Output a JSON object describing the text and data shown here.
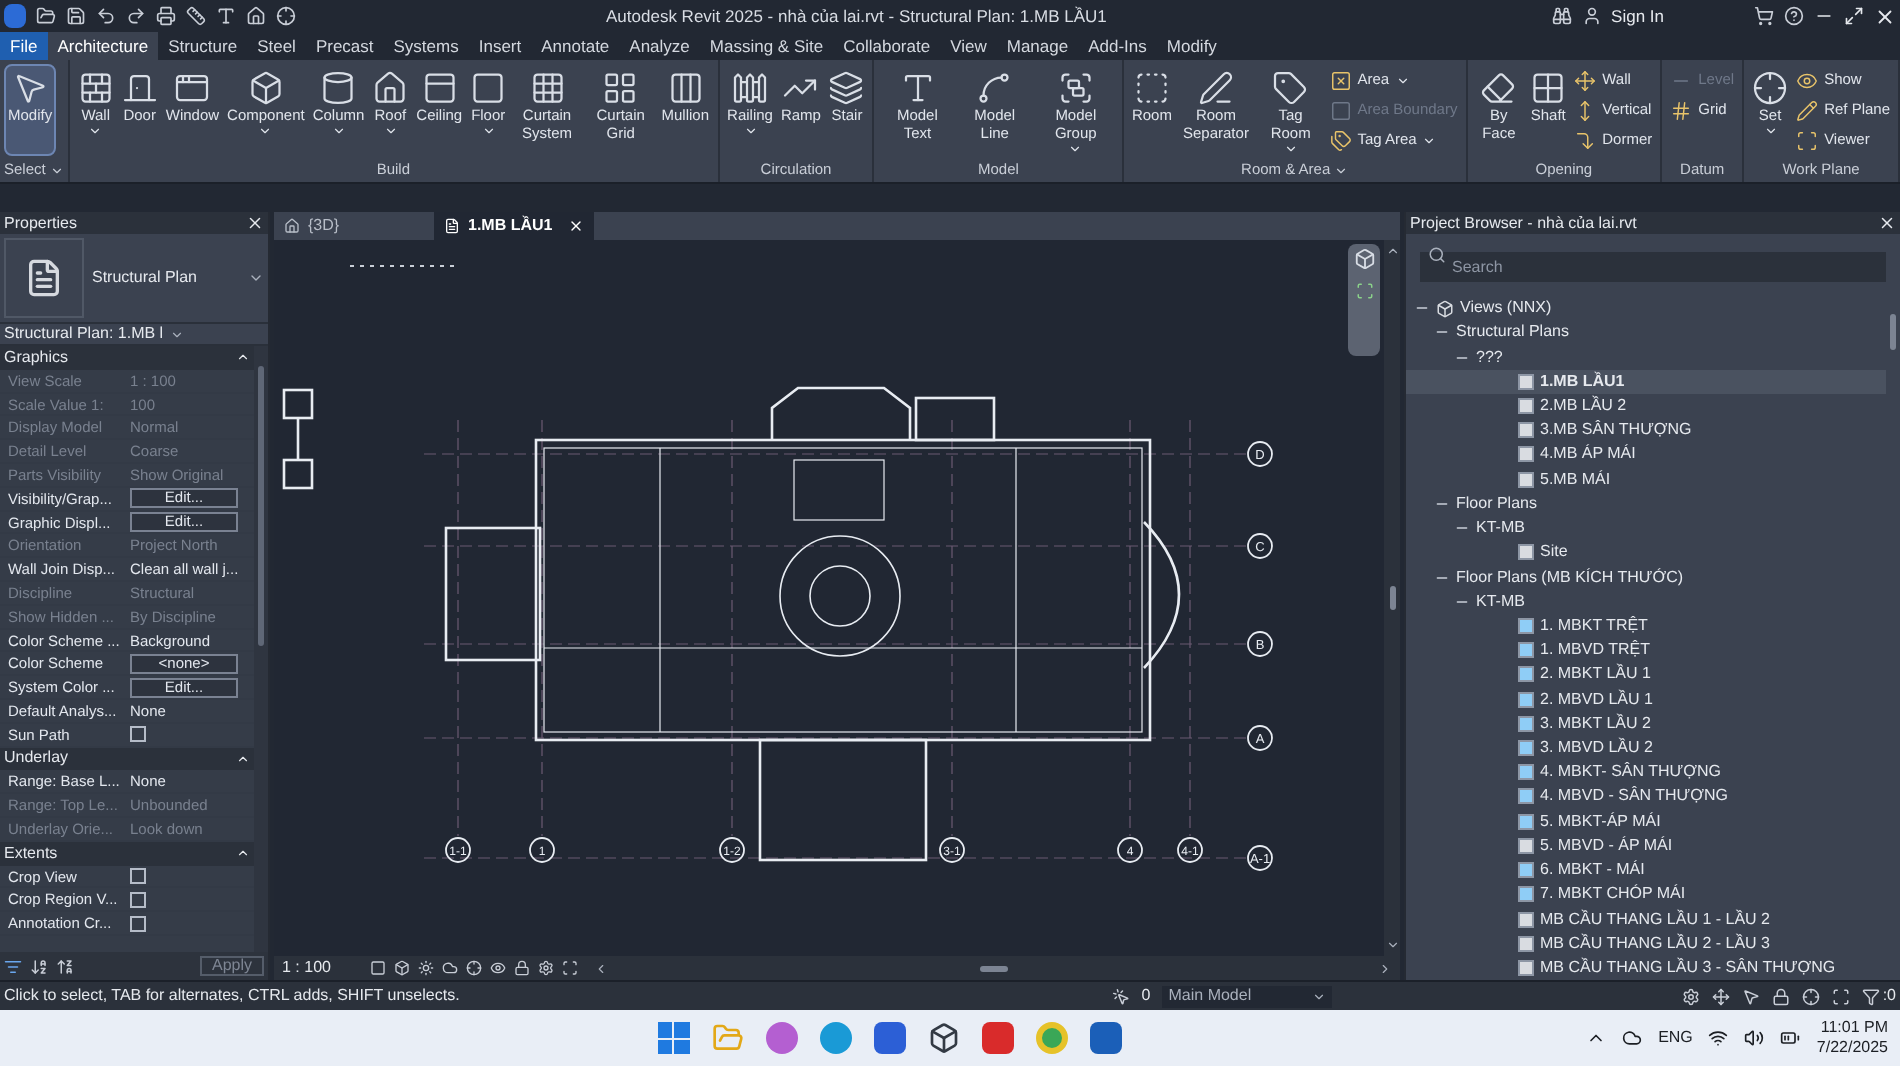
{
  "title_bar": {
    "title": "Autodesk Revit 2025 - nhà của lai.rvt - Structural Plan: 1.MB LẦU1",
    "sign_in": "Sign In"
  },
  "tabs": [
    {
      "label": "File",
      "selected": false,
      "kind": "file"
    },
    {
      "label": "Architecture",
      "selected": true,
      "kind": "tab"
    },
    {
      "label": "Structure",
      "selected": false,
      "kind": "tab"
    },
    {
      "label": "Steel",
      "selected": false,
      "kind": "tab"
    },
    {
      "label": "Precast",
      "selected": false,
      "kind": "tab"
    },
    {
      "label": "Systems",
      "selected": false,
      "kind": "tab"
    },
    {
      "label": "Insert",
      "selected": false,
      "kind": "tab"
    },
    {
      "label": "Annotate",
      "selected": false,
      "kind": "tab"
    },
    {
      "label": "Analyze",
      "selected": false,
      "kind": "tab"
    },
    {
      "label": "Massing & Site",
      "selected": false,
      "kind": "tab"
    },
    {
      "label": "Collaborate",
      "selected": false,
      "kind": "tab"
    },
    {
      "label": "View",
      "selected": false,
      "kind": "tab"
    },
    {
      "label": "Manage",
      "selected": false,
      "kind": "tab"
    },
    {
      "label": "Add-Ins",
      "selected": false,
      "kind": "tab"
    },
    {
      "label": "Modify",
      "selected": false,
      "kind": "tab"
    }
  ],
  "ribbon": {
    "panels": [
      {
        "label": "Select",
        "dropdown": true,
        "items": [
          {
            "label": "Modify",
            "kind": "large",
            "active": true,
            "disabled": false,
            "dropdown": false
          }
        ]
      },
      {
        "label": "Build",
        "dropdown": false,
        "items": [
          {
            "label": "Wall",
            "kind": "large",
            "active": false,
            "disabled": false,
            "dropdown": true
          },
          {
            "label": "Door",
            "kind": "large",
            "active": false,
            "disabled": false,
            "dropdown": false
          },
          {
            "label": "Window",
            "kind": "large",
            "active": false,
            "disabled": false,
            "dropdown": false
          },
          {
            "label": "Component",
            "kind": "large",
            "active": false,
            "disabled": false,
            "dropdown": true
          },
          {
            "label": "Column",
            "kind": "large",
            "active": false,
            "disabled": false,
            "dropdown": true
          },
          {
            "label": "Roof",
            "kind": "large",
            "active": false,
            "disabled": false,
            "dropdown": true
          },
          {
            "label": "Ceiling",
            "kind": "large",
            "active": false,
            "disabled": false,
            "dropdown": false
          },
          {
            "label": "Floor",
            "kind": "large",
            "active": false,
            "disabled": false,
            "dropdown": true
          },
          {
            "label": "Curtain System",
            "kind": "large",
            "active": false,
            "disabled": false,
            "dropdown": false
          },
          {
            "label": "Curtain Grid",
            "kind": "large",
            "active": false,
            "disabled": false,
            "dropdown": false
          },
          {
            "label": "Mullion",
            "kind": "large",
            "active": false,
            "disabled": false,
            "dropdown": false
          }
        ]
      },
      {
        "label": "Circulation",
        "dropdown": false,
        "items": [
          {
            "label": "Railing",
            "kind": "large",
            "active": false,
            "disabled": false,
            "dropdown": true
          },
          {
            "label": "Ramp",
            "kind": "large",
            "active": false,
            "disabled": false,
            "dropdown": false
          },
          {
            "label": "Stair",
            "kind": "large",
            "active": false,
            "disabled": false,
            "dropdown": false
          }
        ]
      },
      {
        "label": "Model",
        "dropdown": false,
        "items": [
          {
            "label": "Model Text",
            "kind": "large",
            "active": false,
            "disabled": false,
            "dropdown": false
          },
          {
            "label": "Model Line",
            "kind": "large",
            "active": false,
            "disabled": false,
            "dropdown": false
          },
          {
            "label": "Model Group",
            "kind": "large",
            "active": false,
            "disabled": false,
            "dropdown": true
          }
        ]
      },
      {
        "label": "Room & Area",
        "dropdown": true,
        "items": [
          {
            "label": "Room",
            "kind": "large",
            "active": false,
            "disabled": false,
            "dropdown": false
          },
          {
            "label": "Room Separator",
            "kind": "large",
            "active": false,
            "disabled": false,
            "dropdown": false
          },
          {
            "label": "Tag Room",
            "kind": "large",
            "active": false,
            "disabled": false,
            "dropdown": true
          },
          {
            "label": "Area",
            "kind": "small",
            "active": false,
            "disabled": false,
            "dropdown": true
          },
          {
            "label": "Area Boundary",
            "kind": "small",
            "active": false,
            "disabled": true,
            "dropdown": false
          },
          {
            "label": "Tag  Area",
            "kind": "small",
            "active": false,
            "disabled": false,
            "dropdown": true
          }
        ]
      },
      {
        "label": "Opening",
        "dropdown": false,
        "items": [
          {
            "label": "By Face",
            "kind": "large",
            "active": false,
            "disabled": false,
            "dropdown": false
          },
          {
            "label": "Shaft",
            "kind": "large",
            "active": false,
            "disabled": false,
            "dropdown": false
          },
          {
            "label": "Wall",
            "kind": "small",
            "active": false,
            "disabled": false,
            "dropdown": false
          },
          {
            "label": "Vertical",
            "kind": "small",
            "active": false,
            "disabled": false,
            "dropdown": false
          },
          {
            "label": "Dormer",
            "kind": "small",
            "active": false,
            "disabled": false,
            "dropdown": false
          }
        ]
      },
      {
        "label": "Datum",
        "dropdown": false,
        "items": [
          {
            "label": "Level",
            "kind": "small",
            "active": false,
            "disabled": true,
            "dropdown": false
          },
          {
            "label": "Grid",
            "kind": "small",
            "active": false,
            "disabled": false,
            "dropdown": false
          }
        ]
      },
      {
        "label": "Work Plane",
        "dropdown": false,
        "items": [
          {
            "label": "Set",
            "kind": "large",
            "active": false,
            "disabled": false,
            "dropdown": true
          },
          {
            "label": "Show",
            "kind": "small",
            "active": false,
            "disabled": false,
            "dropdown": false
          },
          {
            "label": "Ref Plane",
            "kind": "small",
            "active": false,
            "disabled": false,
            "dropdown": false
          },
          {
            "label": "Viewer",
            "kind": "small",
            "active": false,
            "disabled": false,
            "dropdown": false
          }
        ]
      }
    ]
  },
  "properties": {
    "title": "Properties",
    "type_name": "Structural Plan",
    "selector": "Structural Plan: 1.MB l",
    "sections": [
      {
        "title": "Graphics",
        "rows": [
          {
            "label": "View Scale",
            "value": "1 : 100",
            "kind": "text",
            "disabled": true
          },
          {
            "label": "Scale Value    1:",
            "value": "100",
            "kind": "text",
            "disabled": true
          },
          {
            "label": "Display Model",
            "value": "Normal",
            "kind": "text",
            "disabled": true
          },
          {
            "label": "Detail Level",
            "value": "Coarse",
            "kind": "text",
            "disabled": true
          },
          {
            "label": "Parts Visibility",
            "value": "Show Original",
            "kind": "text",
            "disabled": true
          },
          {
            "label": "Visibility/Grap...",
            "value": "Edit...",
            "kind": "button",
            "disabled": false
          },
          {
            "label": "Graphic Displ...",
            "value": "Edit...",
            "kind": "button",
            "disabled": false
          },
          {
            "label": "Orientation",
            "value": "Project North",
            "kind": "text",
            "disabled": true
          },
          {
            "label": "Wall Join Disp...",
            "value": "Clean all wall j...",
            "kind": "text",
            "disabled": false
          },
          {
            "label": "Discipline",
            "value": "Structural",
            "kind": "text",
            "disabled": true
          },
          {
            "label": "Show Hidden ...",
            "value": "By Discipline",
            "kind": "text",
            "disabled": true
          },
          {
            "label": "Color Scheme ...",
            "value": "Background",
            "kind": "text",
            "disabled": false
          },
          {
            "label": "Color Scheme",
            "value": "<none>",
            "kind": "button",
            "disabled": false
          },
          {
            "label": "System Color ...",
            "value": "Edit...",
            "kind": "button",
            "disabled": false
          },
          {
            "label": "Default Analys...",
            "value": "None",
            "kind": "text",
            "disabled": false
          },
          {
            "label": "Sun Path",
            "kind": "checkbox",
            "checked": false,
            "disabled": false
          }
        ]
      },
      {
        "title": "Underlay",
        "rows": [
          {
            "label": "Range: Base L...",
            "value": "None",
            "kind": "text",
            "disabled": false
          },
          {
            "label": "Range: Top Le...",
            "value": "Unbounded",
            "kind": "text",
            "disabled": true
          },
          {
            "label": "Underlay Orie...",
            "value": "Look down",
            "kind": "text",
            "disabled": true
          }
        ]
      },
      {
        "title": "Extents",
        "rows": [
          {
            "label": "Crop View",
            "kind": "checkbox",
            "checked": false,
            "disabled": false
          },
          {
            "label": "Crop Region V...",
            "kind": "checkbox",
            "checked": false,
            "disabled": false
          },
          {
            "label": "Annotation Cr...",
            "kind": "checkbox",
            "checked": false,
            "disabled": false
          }
        ]
      }
    ],
    "apply": "Apply"
  },
  "view_tabs": [
    {
      "label": "{3D}",
      "selected": false
    },
    {
      "label": "1.MB LẦU1",
      "selected": true
    }
  ],
  "canvas": {
    "grid_rows": [
      "D",
      "C",
      "B",
      "A",
      "A-1"
    ],
    "grid_columns": [
      "1-1",
      "1",
      "1-2",
      "3-1",
      "4",
      "4-1"
    ]
  },
  "view_control": {
    "scale": "1 : 100"
  },
  "browser": {
    "title": "Project Browser - nhà của lai.rvt",
    "search": {
      "placeholder": "Search"
    },
    "tree": [
      {
        "label": "Views (NNX)",
        "expanded": true,
        "children": [
          {
            "label": "Structural Plans",
            "expanded": true,
            "children": [
              {
                "label": "???",
                "expanded": true,
                "children": [
                  {
                    "label": "1.MB LẦU1",
                    "selected": true,
                    "placed": false
                  },
                  {
                    "label": "2.MB LẦU 2",
                    "selected": false,
                    "placed": false
                  },
                  {
                    "label": "3.MB SÂN THƯỢNG",
                    "selected": false,
                    "placed": false
                  },
                  {
                    "label": "4.MB ÁP MÁI",
                    "selected": false,
                    "placed": false
                  },
                  {
                    "label": "5.MB MÁI",
                    "selected": false,
                    "placed": false
                  }
                ]
              }
            ]
          },
          {
            "label": "Floor Plans",
            "expanded": true,
            "children": [
              {
                "label": "KT-MB",
                "expanded": true,
                "children": [
                  {
                    "label": "Site",
                    "selected": false,
                    "placed": false
                  }
                ]
              }
            ]
          },
          {
            "label": "Floor Plans (MB KÍCH THƯỚC)",
            "expanded": true,
            "children": [
              {
                "label": "KT-MB",
                "expanded": true,
                "children": [
                  {
                    "label": "1. MBKT TRỆT",
                    "selected": false,
                    "placed": true
                  },
                  {
                    "label": "1. MBVD TRỆT",
                    "selected": false,
                    "placed": true
                  },
                  {
                    "label": "2. MBKT LẦU 1",
                    "selected": false,
                    "placed": true
                  },
                  {
                    "label": "2. MBVD LẦU 1",
                    "selected": false,
                    "placed": true
                  },
                  {
                    "label": "3. MBKT LẦU 2",
                    "selected": false,
                    "placed": true
                  },
                  {
                    "label": "3. MBVD LẦU 2",
                    "selected": false,
                    "placed": true
                  },
                  {
                    "label": "4. MBKT- SÂN THƯỢNG",
                    "selected": false,
                    "placed": true
                  },
                  {
                    "label": "4. MBVD - SÂN THƯỢNG",
                    "selected": false,
                    "placed": true
                  },
                  {
                    "label": "5. MBKT-ÁP MÁI",
                    "selected": false,
                    "placed": true
                  },
                  {
                    "label": "5. MBVD - ÁP MÁI",
                    "selected": false,
                    "placed": false
                  },
                  {
                    "label": "6. MBKT - MÁI",
                    "selected": false,
                    "placed": true
                  },
                  {
                    "label": "7. MBKT CHÓP MÁI",
                    "selected": false,
                    "placed": true
                  },
                  {
                    "label": "MB CẦU THANG LẦU 1 - LẦU 2",
                    "selected": false,
                    "placed": false
                  },
                  {
                    "label": "MB CẦU THANG LẦU 2 - LẦU 3",
                    "selected": false,
                    "placed": false
                  },
                  {
                    "label": "MB CẦU THANG LẦU 3 - SÂN THƯỢNG",
                    "selected": false,
                    "placed": false
                  }
                ]
              }
            ]
          }
        ]
      }
    ]
  },
  "status_bar": {
    "message": "Click to select, TAB for alternates, CTRL adds, SHIFT unselects.",
    "workset_count": "0",
    "model": "Main Model",
    "filter_count": ":0"
  },
  "taskbar": {
    "language": "ENG",
    "time": "11:01 PM",
    "date": "7/22/2025"
  }
}
